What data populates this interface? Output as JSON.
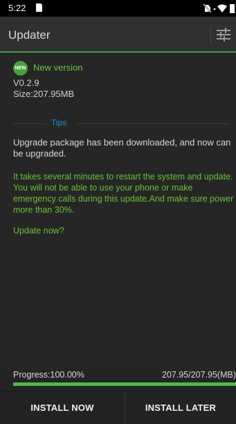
{
  "status_bar": {
    "time": "5:22",
    "icons": [
      "sd-card-icon",
      "mute-icon",
      "wifi-icon",
      "battery-icon"
    ]
  },
  "app_bar": {
    "title": "Updater",
    "settings_icon": "settings-sliders-icon"
  },
  "update": {
    "badge": "NEW",
    "headline": "New version",
    "version": "V0.2.9",
    "size": "Size:207.95MB"
  },
  "tips": {
    "label": "Tips",
    "downloaded_message": "Upgrade package has been downloaded, and now can be upgraded.",
    "warning_message": "It takes several minutes to restart the system and update. You will not be able to use your phone or make emergency calls during this update.And make sure power more than 30%.",
    "confirm_question": "Update now?"
  },
  "progress": {
    "label": "Progress:100.00%",
    "size_text": "207.95/207.95(MB)",
    "fraction": 1.0
  },
  "buttons": {
    "install_now": "INSTALL NOW",
    "install_later": "INSTALL LATER"
  },
  "colors": {
    "accent_green": "#4bbb45",
    "tips_blue": "#1c8fd3",
    "background": "#242424"
  }
}
